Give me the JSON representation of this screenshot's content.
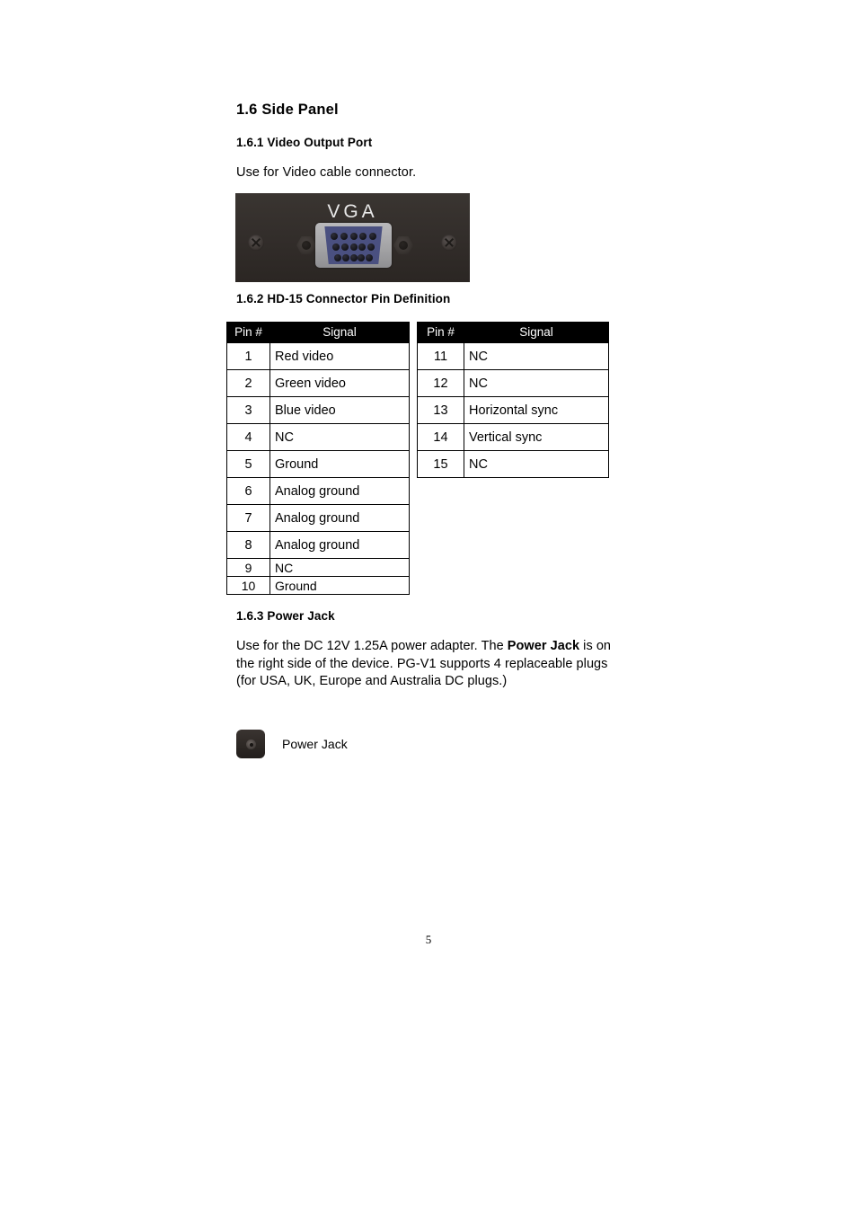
{
  "document": {
    "page_number": "5"
  },
  "sections": {
    "side_panel": {
      "heading": "1.6 Side Panel"
    },
    "video_output": {
      "heading": "1.6.1 Video Output Port",
      "body": "Use for Video cable connector.",
      "panel_image": {
        "label": "VGA",
        "panel_color": "#332e2b",
        "connector_color": "#4a5080",
        "bezel_color": "#a6a6a8",
        "pin_rows": [
          5,
          5,
          5
        ]
      }
    },
    "pin_definition": {
      "heading": "1.6.2 HD-15 Connector Pin Definition",
      "columns": [
        "Pin #",
        "Signal"
      ],
      "left_rows": [
        {
          "pin": "1",
          "signal": "Red video"
        },
        {
          "pin": "2",
          "signal": "Green video"
        },
        {
          "pin": "3",
          "signal": "Blue video"
        },
        {
          "pin": "4",
          "signal": "NC"
        },
        {
          "pin": "5",
          "signal": "Ground"
        },
        {
          "pin": "6",
          "signal": "Analog ground"
        },
        {
          "pin": "7",
          "signal": "Analog ground"
        },
        {
          "pin": "8",
          "signal": "Analog ground"
        },
        {
          "pin": "9",
          "signal": "NC"
        },
        {
          "pin": "10",
          "signal": "Ground"
        }
      ],
      "right_rows": [
        {
          "pin": "11",
          "signal": "NC"
        },
        {
          "pin": "12",
          "signal": "NC"
        },
        {
          "pin": "13",
          "signal": "Horizontal sync"
        },
        {
          "pin": "14",
          "signal": "Vertical sync"
        },
        {
          "pin": "15",
          "signal": "NC"
        }
      ]
    },
    "power_jack": {
      "heading": "1.6.3 Power Jack",
      "paragraph_part1": "Use for the DC 12V 1.25A power adapter. The ",
      "paragraph_bold": "Power Jack",
      "paragraph_part2": " is on the right side of the device. PG-V1 supports 4 replaceable plugs (for USA, UK, Europe and Australia DC plugs.)",
      "image_label": "Power Jack"
    }
  }
}
